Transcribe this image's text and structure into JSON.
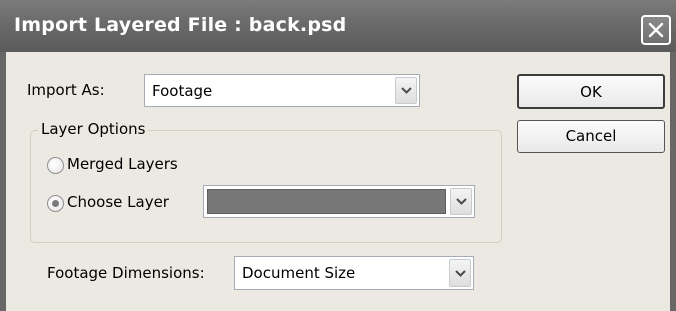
{
  "window": {
    "title": "Import Layered File : back.psd"
  },
  "import_as": {
    "label": "Import As:",
    "value": "Footage"
  },
  "layer_options": {
    "title": "Layer Options",
    "merged_label": "Merged Layers",
    "choose_label": "Choose Layer",
    "selected": "Choose Layer",
    "layer_value": ""
  },
  "footage_dimensions": {
    "label": "Footage Dimensions:",
    "value": "Document Size"
  },
  "buttons": {
    "ok": "OK",
    "cancel": "Cancel"
  },
  "icons": {
    "close": "close-icon",
    "dropdown": "chevron-down-icon"
  },
  "colors": {
    "titlebar": "#6a6a6a",
    "dialog_bg": "#ebe9e2",
    "disabled_fill": "#777777"
  }
}
